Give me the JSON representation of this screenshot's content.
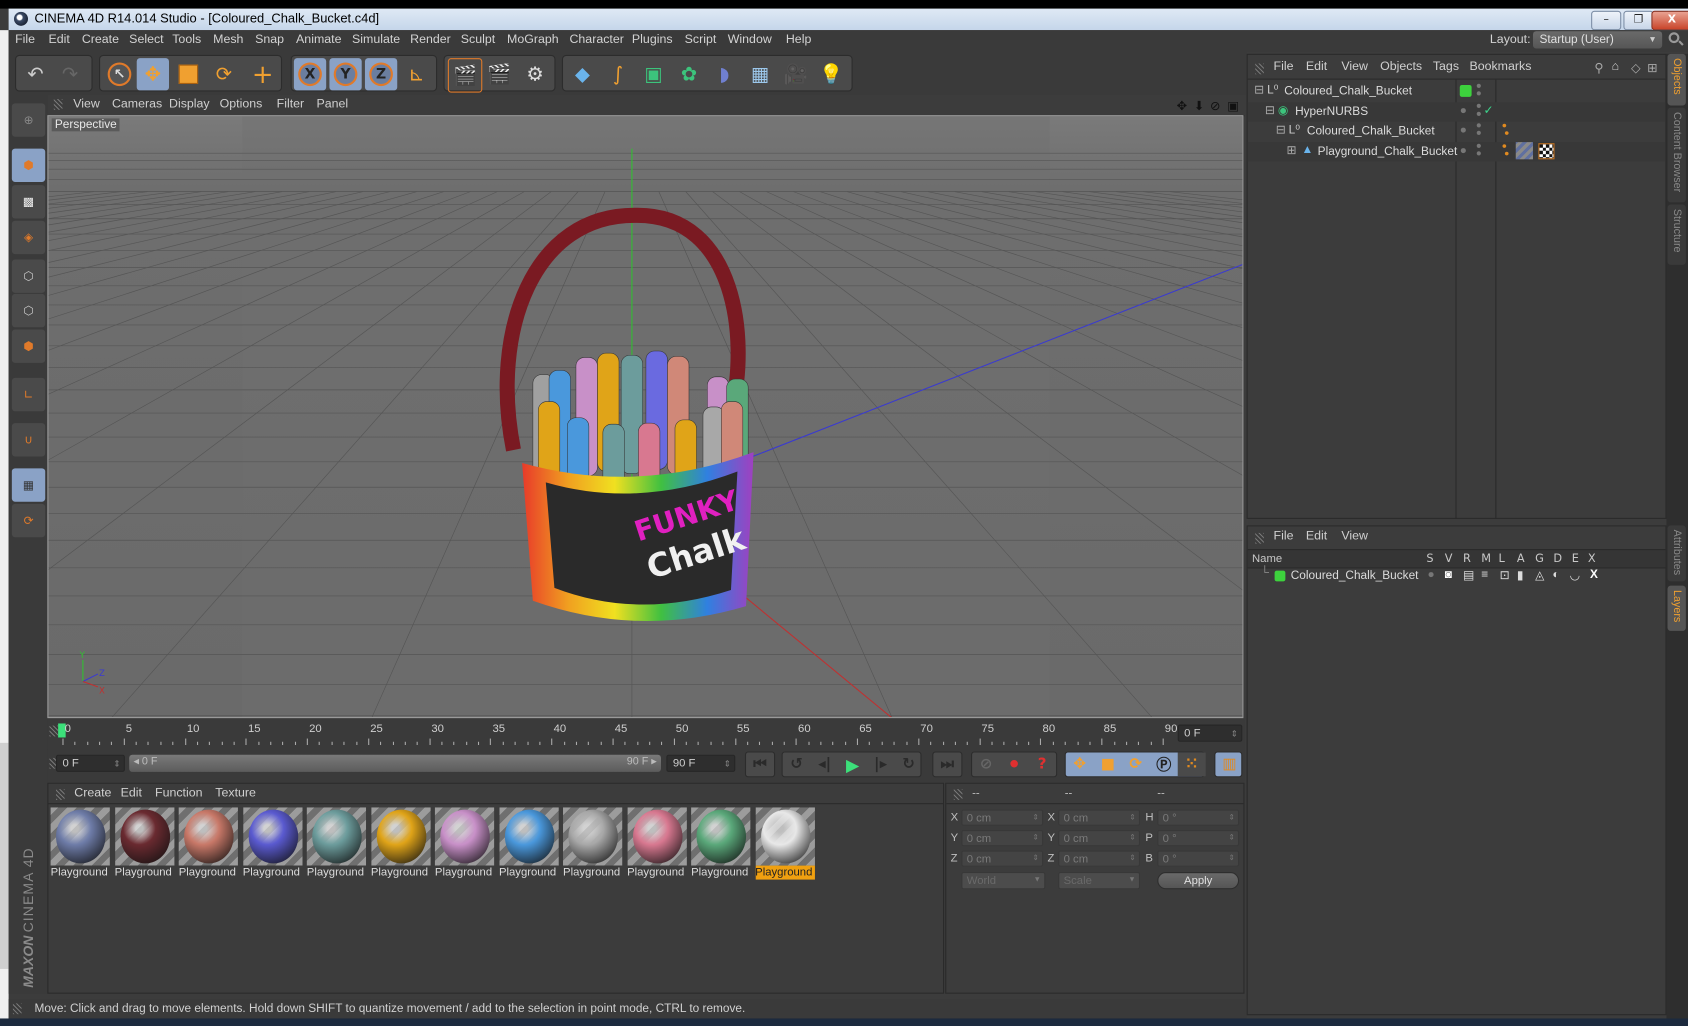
{
  "window": {
    "title": "CINEMA 4D R14.014 Studio - [Coloured_Chalk_Bucket.c4d]",
    "minimize": "–",
    "restore": "❐",
    "close": "X"
  },
  "menubar": {
    "items": [
      "File",
      "Edit",
      "Create",
      "Select",
      "Tools",
      "Mesh",
      "Snap",
      "Animate",
      "Simulate",
      "Render",
      "Sculpt",
      "MoGraph",
      "Character",
      "Plugins",
      "Script",
      "Window",
      "Help"
    ],
    "layout_label": "Layout:",
    "layout_value": "Startup (User)"
  },
  "toolbar": {
    "groups": [
      {
        "name": "history",
        "icons": [
          "undo-icon",
          "redo-icon"
        ]
      },
      {
        "name": "transform",
        "icons": [
          "live-selection-icon",
          "move-icon",
          "scale-icon",
          "rotate-icon"
        ]
      },
      {
        "name": "last-tool",
        "icons": [
          "recent-tool-icon"
        ]
      },
      {
        "name": "axis-lock",
        "icons": [
          "x-axis-icon",
          "y-axis-icon",
          "z-axis-icon",
          "coordinate-system-icon"
        ]
      },
      {
        "name": "render",
        "icons": [
          "render-view-icon",
          "render-picture-viewer-icon",
          "render-settings-icon"
        ]
      },
      {
        "name": "create",
        "icons": [
          "cube-icon",
          "spline-icon",
          "nurbs-icon",
          "array-icon",
          "deformer-icon",
          "floor-icon",
          "camera-icon",
          "light-icon"
        ]
      }
    ],
    "axis_labels": [
      "X",
      "Y",
      "Z"
    ]
  },
  "left_toolbar": {
    "tools": [
      "make-editable",
      "model-mode",
      "texture-mode",
      "workplane-mode",
      "points-mode",
      "edges-mode",
      "polygons-mode",
      "axis-mode",
      "snap",
      "locked-workplane",
      "planar-workplane"
    ]
  },
  "viewport": {
    "menu": [
      "View",
      "Cameras",
      "Display",
      "Options",
      "Filter",
      "Panel"
    ],
    "camera_label": "Perspective",
    "axis_labels": {
      "x": "X",
      "y": "Y",
      "z": "Z"
    },
    "model_text": [
      "FUNKY",
      "Chalk"
    ],
    "colors": {
      "x_axis": "#c03030",
      "y_axis": "#30b030",
      "z_axis": "#3a3ad0",
      "handle": "#7a1a22"
    }
  },
  "objects_panel": {
    "menu": [
      "File",
      "Edit",
      "View",
      "Objects",
      "Tags",
      "Bookmarks"
    ],
    "tree": [
      {
        "label": "Coloured_Chalk_Bucket",
        "type": "null",
        "depth": 0,
        "expanded": true,
        "color_tag": "#3dd23d"
      },
      {
        "label": "HyperNURBS",
        "type": "hypernurbs",
        "depth": 1,
        "expanded": true,
        "enabled_check": "✓"
      },
      {
        "label": "Coloured_Chalk_Bucket",
        "type": "null",
        "depth": 2,
        "expanded": true
      },
      {
        "label": "Playground_Chalk_Bucket",
        "type": "polygon",
        "depth": 3,
        "expanded": false
      }
    ]
  },
  "layers_panel": {
    "menu": [
      "File",
      "Edit",
      "View"
    ],
    "columns": [
      "Name",
      "S",
      "V",
      "R",
      "M",
      "L",
      "A",
      "G",
      "D",
      "E",
      "X"
    ],
    "rows": [
      {
        "name": "Coloured_Chalk_Bucket",
        "color": "#3dd23d"
      }
    ]
  },
  "side_tabs": {
    "top": [
      {
        "label": "Objects",
        "active": true
      },
      {
        "label": "Content Browser",
        "active": false
      },
      {
        "label": "Structure",
        "active": false
      }
    ],
    "bottom": [
      {
        "label": "Attributes",
        "active": false
      },
      {
        "label": "Layers",
        "active": true
      }
    ]
  },
  "timeline": {
    "ticks": [
      "0",
      "5",
      "10",
      "15",
      "20",
      "25",
      "30",
      "35",
      "40",
      "45",
      "50",
      "55",
      "60",
      "65",
      "70",
      "75",
      "80",
      "85",
      "90"
    ],
    "current_frame_display": "0 F",
    "min_field": "0 F",
    "range_start": "0 F",
    "range_end": "90 F",
    "max_field": "90 F",
    "current_frame": 0,
    "max_frame": 90
  },
  "transport": {
    "buttons": [
      "go-to-start",
      "play-backwards-loop",
      "previous-frame",
      "play-forwards",
      "next-frame",
      "play-loop",
      "go-to-end"
    ],
    "key_buttons": [
      "record-disabled",
      "autokey",
      "keyframe-selection"
    ],
    "track_buttons": [
      "position-track",
      "scale-track",
      "rotation-track",
      "parameter-track",
      "point-level-animation"
    ],
    "timeline_button": "timeline-window"
  },
  "materials": {
    "menu": [
      "Create",
      "Edit",
      "Function",
      "Texture"
    ],
    "items": [
      {
        "label": "Playground",
        "color": "#6e7ca8",
        "selected": false
      },
      {
        "label": "Playground",
        "color": "#6a2a30",
        "selected": false
      },
      {
        "label": "Playground",
        "color": "#c87868",
        "selected": false
      },
      {
        "label": "Playground",
        "color": "#5a5ad0",
        "selected": false
      },
      {
        "label": "Playground",
        "color": "#6c9c9c",
        "selected": false
      },
      {
        "label": "Playground",
        "color": "#e0a418",
        "selected": false
      },
      {
        "label": "Playground",
        "color": "#c890c8",
        "selected": false
      },
      {
        "label": "Playground",
        "color": "#4a98dc",
        "selected": false
      },
      {
        "label": "Playground",
        "color": "#a8a8a8",
        "selected": false
      },
      {
        "label": "Playground",
        "color": "#d87890",
        "selected": false
      },
      {
        "label": "Playground",
        "color": "#5aa87a",
        "selected": false
      },
      {
        "label": "Playground",
        "color": "#e8e8e8",
        "selected": true
      }
    ]
  },
  "coordinates": {
    "headers": [
      "--",
      "--",
      "--"
    ],
    "rows": [
      {
        "l1": "X",
        "v1": "0 cm",
        "l2": "X",
        "v2": "0 cm",
        "l3": "H",
        "v3": "0 °"
      },
      {
        "l1": "Y",
        "v1": "0 cm",
        "l2": "Y",
        "v2": "0 cm",
        "l3": "P",
        "v3": "0 °"
      },
      {
        "l1": "Z",
        "v1": "0 cm",
        "l2": "Z",
        "v2": "0 cm",
        "l3": "B",
        "v3": "0 °"
      }
    ],
    "space_select": "World",
    "mode_select": "Scale",
    "apply_label": "Apply"
  },
  "status": {
    "text": "Move: Click and drag to move elements. Hold down SHIFT to quantize movement / add to the selection in point mode, CTRL to remove."
  },
  "branding": {
    "maxon": "MAXON",
    "product": "CINEMA 4D"
  }
}
